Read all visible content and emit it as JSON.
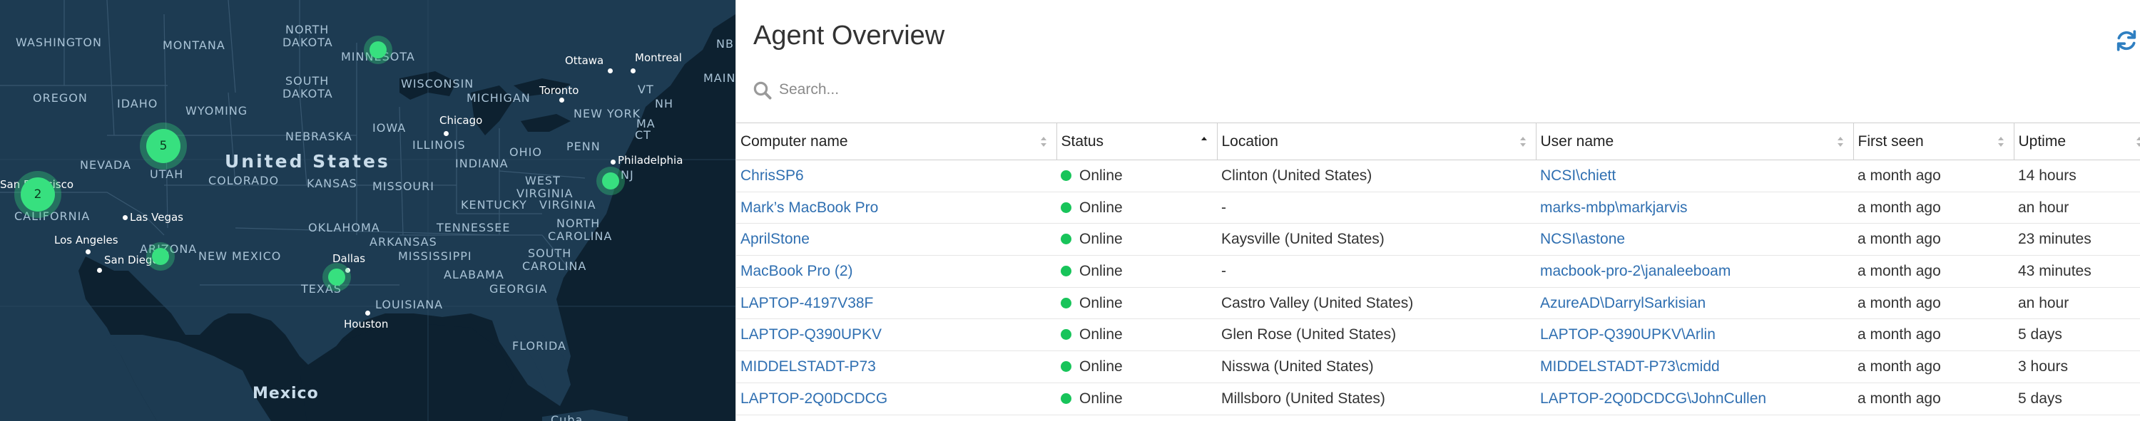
{
  "map": {
    "labels": {
      "washington": "WASHINGTON",
      "montana": "MONTANA",
      "north_dakota_1": "NORTH",
      "north_dakota_2": "DAKOTA",
      "minnesota": "MINNESOTA",
      "south_dakota_1": "SOUTH",
      "south_dakota_2": "DAKOTA",
      "wisconsin": "WISCONSIN",
      "oregon": "OREGON",
      "idaho": "IDAHO",
      "wyoming": "WYOMING",
      "michigan": "MICHIGAN",
      "nebraska": "NEBRASKA",
      "iowa": "IOWA",
      "nevada": "NEVADA",
      "utah": "UTAH",
      "united_states": "United States",
      "colorado": "COLORADO",
      "kansas": "KANSAS",
      "missouri": "MISSOURI",
      "illinois": "ILLINOIS",
      "indiana": "INDIANA",
      "ohio": "OHIO",
      "penn": "PENN",
      "new_york": "NEW YORK",
      "vt": "VT",
      "nh": "NH",
      "ma": "MA",
      "ct": "CT",
      "nj": "NJ",
      "maine": "MAINE",
      "nb": "NB",
      "california": "CALIFORNIA",
      "arizona": "ARIZONA",
      "new_mexico": "NEW MEXICO",
      "oklahoma": "OKLAHOMA",
      "arkansas": "ARKANSAS",
      "tennessee": "TENNESSEE",
      "kentucky": "KENTUCKY",
      "west_virginia_1": "WEST",
      "west_virginia_2": "VIRGINIA",
      "virginia": "VIRGINIA",
      "north_carolina_1": "NORTH",
      "north_carolina_2": "CAROLINA",
      "south_carolina_1": "SOUTH",
      "south_carolina_2": "CAROLINA",
      "mississippi": "MISSISSIPPI",
      "alabama": "ALABAMA",
      "georgia": "GEORGIA",
      "louisiana": "LOUISIANA",
      "texas": "TEXAS",
      "florida": "FLORIDA",
      "mexico": "Mexico",
      "cuba": "Cuba"
    },
    "cities": {
      "ottawa": "Ottawa",
      "montreal": "Montreal",
      "toronto": "Toronto",
      "chicago": "Chicago",
      "philadelphia": "Philadelphia",
      "las_vegas": "Las Vegas",
      "los_angeles": "Los Angeles",
      "san_diego": "San Diego",
      "san_francisco": "San Francisco",
      "dallas": "Dallas",
      "houston": "Houston"
    },
    "clusters": {
      "utah": "5",
      "california": "2"
    },
    "colors": {
      "water": "#0d2130",
      "land": "#1d3b52",
      "cluster": "#37e07f"
    }
  },
  "panel": {
    "title": "Agent Overview",
    "refresh_icon": "refresh-icon",
    "search": {
      "placeholder": "Search...",
      "value": ""
    },
    "columns": [
      "Computer name",
      "Status",
      "Location",
      "User name",
      "First seen",
      "Uptime"
    ],
    "sorted_column": "Status",
    "rows": [
      {
        "computer": "ChrisSP6",
        "status": "Online",
        "location": "Clinton (United States)",
        "user": "NCSI\\chiett",
        "first_seen": "a month ago",
        "uptime": "14 hours"
      },
      {
        "computer": "Mark’s MacBook Pro",
        "status": "Online",
        "location": "-",
        "user": "marks-mbp\\markjarvis",
        "first_seen": "a month ago",
        "uptime": "an hour"
      },
      {
        "computer": "AprilStone",
        "status": "Online",
        "location": "Kaysville (United States)",
        "user": "NCSI\\astone",
        "first_seen": "a month ago",
        "uptime": "23 minutes"
      },
      {
        "computer": "MacBook Pro (2)",
        "status": "Online",
        "location": "-",
        "user": "macbook-pro-2\\janaleeboam",
        "first_seen": "a month ago",
        "uptime": "43 minutes"
      },
      {
        "computer": "LAPTOP-4197V38F",
        "status": "Online",
        "location": "Castro Valley (United States)",
        "user": "AzureAD\\DarrylSarkisian",
        "first_seen": "a month ago",
        "uptime": "an hour"
      },
      {
        "computer": "LAPTOP-Q390UPKV",
        "status": "Online",
        "location": "Glen Rose (United States)",
        "user": "LAPTOP-Q390UPKV\\Arlin",
        "first_seen": "a month ago",
        "uptime": "5 days"
      },
      {
        "computer": "MIDDELSTADT-P73",
        "status": "Online",
        "location": "Nisswa (United States)",
        "user": "MIDDELSTADT-P73\\cmidd",
        "first_seen": "a month ago",
        "uptime": "3 hours"
      },
      {
        "computer": "LAPTOP-2Q0DCDCG",
        "status": "Online",
        "location": "Millsboro (United States)",
        "user": "LAPTOP-2Q0DCDCG\\JohnCullen",
        "first_seen": "a month ago",
        "uptime": "5 days"
      }
    ],
    "colors": {
      "link": "#2f6fb1",
      "online": "#18c45a",
      "accent": "#2f7fc1"
    }
  }
}
